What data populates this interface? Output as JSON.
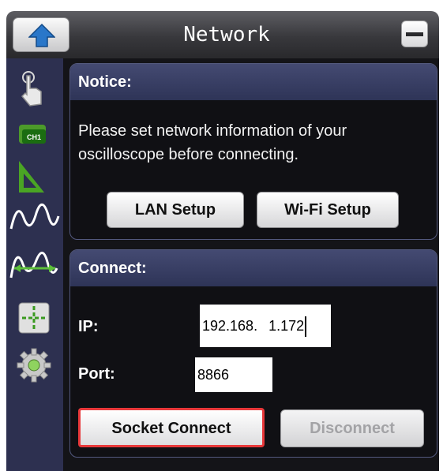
{
  "window": {
    "title": "Network",
    "up_icon": "up-arrow-icon",
    "minimize_icon": "minimize-icon"
  },
  "toolbar": {
    "items": [
      {
        "icon": "touch-pointer-icon"
      },
      {
        "icon": "channel-icon",
        "label": "CH1"
      },
      {
        "icon": "ruler-triangle-icon"
      },
      {
        "icon": "waveform-icon"
      },
      {
        "icon": "waveform-measure-icon"
      },
      {
        "icon": "cursor-crosshair-icon"
      },
      {
        "icon": "gear-icon"
      }
    ]
  },
  "notice": {
    "heading": "Notice:",
    "message": "Please set network information of your oscilloscope before connecting.",
    "lan_button": "LAN Setup",
    "wifi_button": "Wi-Fi Setup"
  },
  "connect": {
    "heading": "Connect:",
    "ip_label": "IP:",
    "ip_part1": "192.168.",
    "ip_part2": "1.172",
    "port_label": "Port:",
    "port_value": "8866",
    "socket_button": "Socket Connect",
    "disconnect_button": "Disconnect"
  },
  "colors": {
    "panel_header": "#3a4068",
    "toolbar_bg": "#2d3050",
    "highlight": "#e8383a",
    "disabled_text": "#a3a3a6"
  }
}
